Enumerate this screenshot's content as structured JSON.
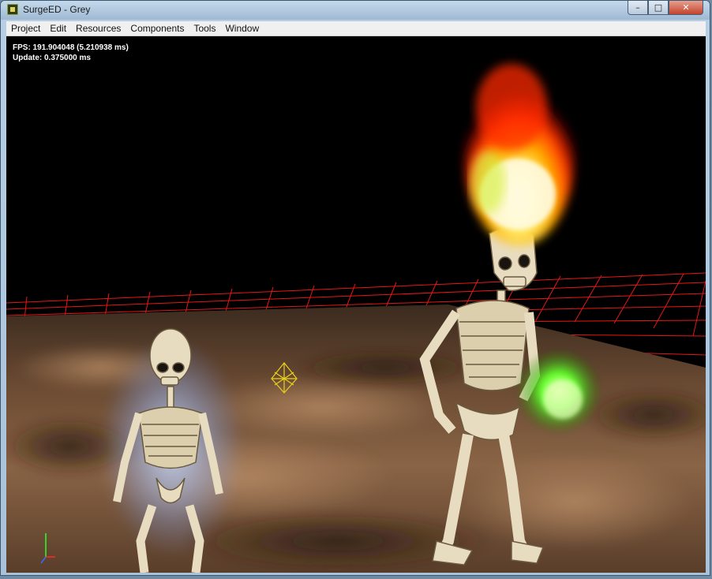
{
  "window": {
    "title": "SurgeED - Grey",
    "minimize_glyph": "–",
    "maximize_glyph": "□",
    "close_glyph": "✕"
  },
  "menu": {
    "items": [
      "Project",
      "Edit",
      "Resources",
      "Components",
      "Tools",
      "Window"
    ]
  },
  "stats": {
    "fps": "FPS: 191.904048 (5.210938 ms)",
    "update": "Update: 0.375000 ms"
  },
  "icons": {
    "app": "surge-app-icon",
    "gizmo": "selection-gizmo-icon",
    "axis": "axis-indicator-icon"
  },
  "colors": {
    "grid": "#ff1a1a",
    "gizmo": "#e8d21a",
    "bone": "#e8dcc0",
    "flame_core": "#fff6c8",
    "flame_outer": "#ff2200",
    "green_flame": "#6bff3a"
  }
}
